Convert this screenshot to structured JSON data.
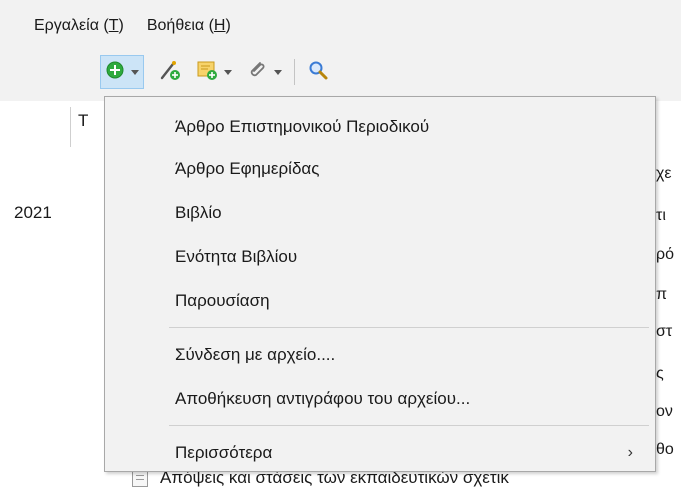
{
  "menubar": {
    "items": [
      {
        "label": "Εργαλεία (",
        "key": "T",
        "suffix": ")"
      },
      {
        "label": "Βοήθεια (",
        "key": "H",
        "suffix": ")"
      }
    ]
  },
  "toolbar": {
    "buttons": [
      {
        "icon": "add-circle-icon",
        "color": "#2eaa3e"
      },
      {
        "icon": "magic-wand-add-icon"
      },
      {
        "icon": "note-add-icon",
        "color": "#f0c23a"
      },
      {
        "icon": "paperclip-icon"
      },
      {
        "icon": "search-icon",
        "color": "#3a7bd5"
      }
    ]
  },
  "background": {
    "column_header_stub": "T",
    "year": "2021",
    "fragments": [
      "χε",
      "τι",
      "ρό",
      "π",
      "στ",
      "ς",
      "ον",
      "θο"
    ],
    "bottom_row_text": "Απόψεις και στάσεις των εκπαιδευτικών σχετικ"
  },
  "dropdown": {
    "items": [
      "Άρθρο Επιστημονικού Περιοδικού",
      "Άρθρο Εφημερίδας",
      "Βιβλίο",
      "Ενότητα Βιβλίου",
      "Παρουσίαση"
    ],
    "file_items": [
      "Σύνδεση με αρχείο....",
      "Αποθήκευση αντιγράφου του αρχείου..."
    ],
    "more_label": "Περισσότερα",
    "more_arrow": "›"
  },
  "colors": {
    "menu_bg": "#f2f2f2",
    "active_button_bg": "#cce4f7",
    "active_button_border": "#99c9ef"
  }
}
